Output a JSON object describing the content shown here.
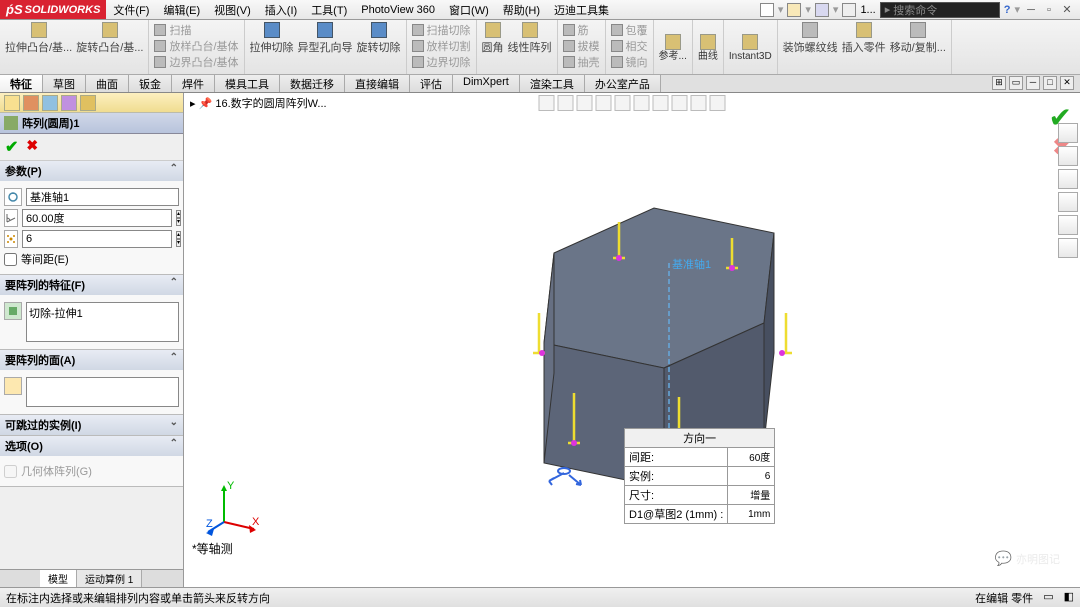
{
  "app": {
    "name": "SOLIDWORKS"
  },
  "menu": {
    "items": [
      "文件(F)",
      "编辑(E)",
      "视图(V)",
      "插入(I)",
      "工具(T)",
      "PhotoView 360",
      "窗口(W)",
      "帮助(H)",
      "迈迪工具集"
    ],
    "search_placeholder": "搜索命令",
    "doc_num": "1..."
  },
  "ribbon": {
    "groups": [
      {
        "items": [
          {
            "label": "拉伸凸台/基..."
          },
          {
            "label": "旋转凸台/基..."
          }
        ]
      },
      {
        "items": [
          {
            "label": "扫描"
          },
          {
            "label": "放样凸台/基体"
          },
          {
            "label": "边界凸台/基体"
          }
        ]
      },
      {
        "items": [
          {
            "label": "拉伸切除"
          },
          {
            "label": "异型孔向导"
          },
          {
            "label": "旋转切除"
          }
        ]
      },
      {
        "items": [
          {
            "label": "扫描切除"
          },
          {
            "label": "放样切割"
          },
          {
            "label": "边界切除"
          }
        ]
      },
      {
        "items": [
          {
            "label": "圆角"
          },
          {
            "label": "线性阵列"
          }
        ]
      },
      {
        "items": [
          {
            "label": "筋"
          },
          {
            "label": "拔模"
          },
          {
            "label": "抽壳"
          }
        ]
      },
      {
        "items": [
          {
            "label": "包覆"
          },
          {
            "label": "相交"
          },
          {
            "label": "镜向"
          }
        ]
      },
      {
        "items": [
          {
            "label": "参考..."
          }
        ]
      },
      {
        "items": [
          {
            "label": "曲线"
          }
        ]
      },
      {
        "items": [
          {
            "label": "Instant3D"
          }
        ]
      },
      {
        "items": [
          {
            "label": "装饰螺纹线"
          },
          {
            "label": "插入零件"
          },
          {
            "label": "移动/复制..."
          }
        ]
      }
    ]
  },
  "feature_tabs": {
    "tabs": [
      "特征",
      "草图",
      "曲面",
      "钣金",
      "焊件",
      "模具工具",
      "数据迁移",
      "直接编辑",
      "评估",
      "DimXpert",
      "渲染工具",
      "办公室产品"
    ],
    "active": 0
  },
  "doc_title": "16.数字的圆周阵列W...",
  "property_manager": {
    "title": "阵列(圆周)1",
    "sections": {
      "params": {
        "header": "参数(P)",
        "axis": "基准轴1",
        "angle": "60.00度",
        "count": "6",
        "equal_spacing": "等间距(E)"
      },
      "features": {
        "header": "要阵列的特征(F)",
        "item": "切除-拉伸1"
      },
      "faces": {
        "header": "要阵列的面(A)"
      },
      "skip": {
        "header": "可跳过的实例(I)"
      },
      "options": {
        "header": "选项(O)",
        "geom_pattern": "几何体阵列(G)"
      }
    },
    "bottom_tabs": [
      "模型",
      "运动算例 1"
    ]
  },
  "direction_table": {
    "title": "方向一",
    "rows": [
      {
        "label": "间距:",
        "value": "60度"
      },
      {
        "label": "实例:",
        "value": "6"
      },
      {
        "label": "尺寸:",
        "value": "增量"
      },
      {
        "label": "D1@草图2 (1mm) :",
        "value": "1mm"
      }
    ]
  },
  "axis_label": "基准轴1",
  "view_label": "*等轴测",
  "status": {
    "left": "在标注内选择或来编辑排列内容或单击箭头来反转方向",
    "right1": "在编辑 零件"
  },
  "watermark": "亦明图记"
}
